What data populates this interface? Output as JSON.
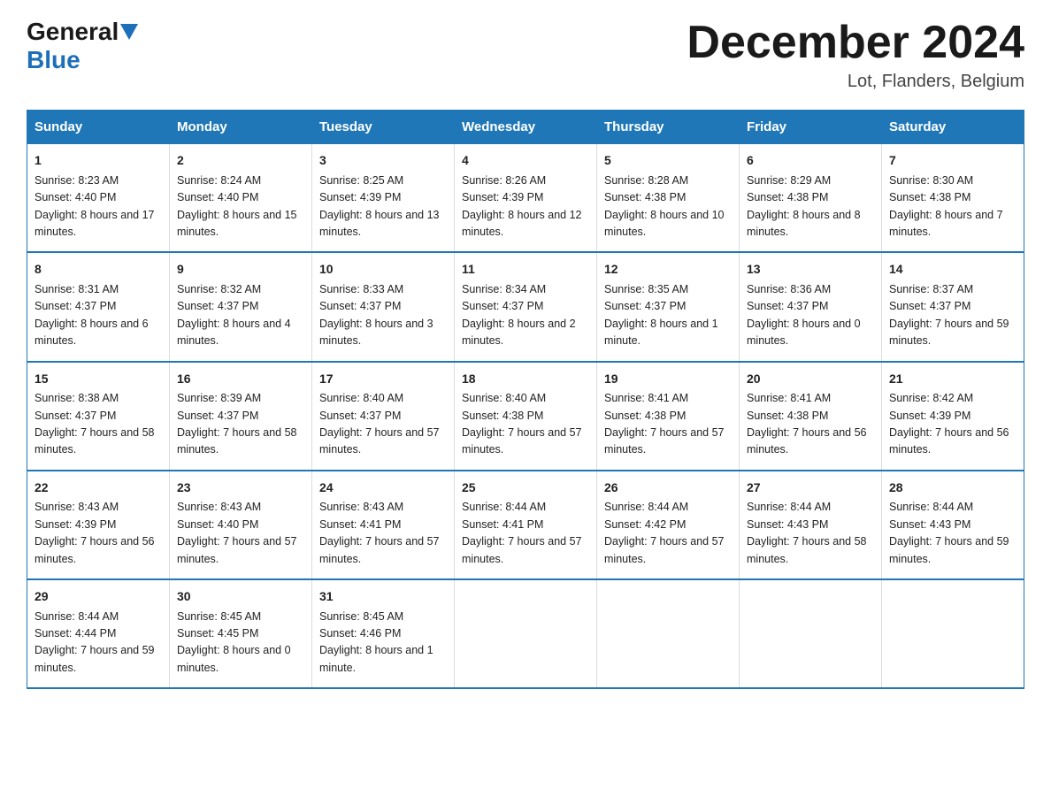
{
  "header": {
    "logo_general": "General",
    "logo_blue": "Blue",
    "month_title": "December 2024",
    "location": "Lot, Flanders, Belgium"
  },
  "days_of_week": [
    "Sunday",
    "Monday",
    "Tuesday",
    "Wednesday",
    "Thursday",
    "Friday",
    "Saturday"
  ],
  "weeks": [
    [
      {
        "day": "1",
        "sunrise": "8:23 AM",
        "sunset": "4:40 PM",
        "daylight": "8 hours and 17 minutes."
      },
      {
        "day": "2",
        "sunrise": "8:24 AM",
        "sunset": "4:40 PM",
        "daylight": "8 hours and 15 minutes."
      },
      {
        "day": "3",
        "sunrise": "8:25 AM",
        "sunset": "4:39 PM",
        "daylight": "8 hours and 13 minutes."
      },
      {
        "day": "4",
        "sunrise": "8:26 AM",
        "sunset": "4:39 PM",
        "daylight": "8 hours and 12 minutes."
      },
      {
        "day": "5",
        "sunrise": "8:28 AM",
        "sunset": "4:38 PM",
        "daylight": "8 hours and 10 minutes."
      },
      {
        "day": "6",
        "sunrise": "8:29 AM",
        "sunset": "4:38 PM",
        "daylight": "8 hours and 8 minutes."
      },
      {
        "day": "7",
        "sunrise": "8:30 AM",
        "sunset": "4:38 PM",
        "daylight": "8 hours and 7 minutes."
      }
    ],
    [
      {
        "day": "8",
        "sunrise": "8:31 AM",
        "sunset": "4:37 PM",
        "daylight": "8 hours and 6 minutes."
      },
      {
        "day": "9",
        "sunrise": "8:32 AM",
        "sunset": "4:37 PM",
        "daylight": "8 hours and 4 minutes."
      },
      {
        "day": "10",
        "sunrise": "8:33 AM",
        "sunset": "4:37 PM",
        "daylight": "8 hours and 3 minutes."
      },
      {
        "day": "11",
        "sunrise": "8:34 AM",
        "sunset": "4:37 PM",
        "daylight": "8 hours and 2 minutes."
      },
      {
        "day": "12",
        "sunrise": "8:35 AM",
        "sunset": "4:37 PM",
        "daylight": "8 hours and 1 minute."
      },
      {
        "day": "13",
        "sunrise": "8:36 AM",
        "sunset": "4:37 PM",
        "daylight": "8 hours and 0 minutes."
      },
      {
        "day": "14",
        "sunrise": "8:37 AM",
        "sunset": "4:37 PM",
        "daylight": "7 hours and 59 minutes."
      }
    ],
    [
      {
        "day": "15",
        "sunrise": "8:38 AM",
        "sunset": "4:37 PM",
        "daylight": "7 hours and 58 minutes."
      },
      {
        "day": "16",
        "sunrise": "8:39 AM",
        "sunset": "4:37 PM",
        "daylight": "7 hours and 58 minutes."
      },
      {
        "day": "17",
        "sunrise": "8:40 AM",
        "sunset": "4:37 PM",
        "daylight": "7 hours and 57 minutes."
      },
      {
        "day": "18",
        "sunrise": "8:40 AM",
        "sunset": "4:38 PM",
        "daylight": "7 hours and 57 minutes."
      },
      {
        "day": "19",
        "sunrise": "8:41 AM",
        "sunset": "4:38 PM",
        "daylight": "7 hours and 57 minutes."
      },
      {
        "day": "20",
        "sunrise": "8:41 AM",
        "sunset": "4:38 PM",
        "daylight": "7 hours and 56 minutes."
      },
      {
        "day": "21",
        "sunrise": "8:42 AM",
        "sunset": "4:39 PM",
        "daylight": "7 hours and 56 minutes."
      }
    ],
    [
      {
        "day": "22",
        "sunrise": "8:43 AM",
        "sunset": "4:39 PM",
        "daylight": "7 hours and 56 minutes."
      },
      {
        "day": "23",
        "sunrise": "8:43 AM",
        "sunset": "4:40 PM",
        "daylight": "7 hours and 57 minutes."
      },
      {
        "day": "24",
        "sunrise": "8:43 AM",
        "sunset": "4:41 PM",
        "daylight": "7 hours and 57 minutes."
      },
      {
        "day": "25",
        "sunrise": "8:44 AM",
        "sunset": "4:41 PM",
        "daylight": "7 hours and 57 minutes."
      },
      {
        "day": "26",
        "sunrise": "8:44 AM",
        "sunset": "4:42 PM",
        "daylight": "7 hours and 57 minutes."
      },
      {
        "day": "27",
        "sunrise": "8:44 AM",
        "sunset": "4:43 PM",
        "daylight": "7 hours and 58 minutes."
      },
      {
        "day": "28",
        "sunrise": "8:44 AM",
        "sunset": "4:43 PM",
        "daylight": "7 hours and 59 minutes."
      }
    ],
    [
      {
        "day": "29",
        "sunrise": "8:44 AM",
        "sunset": "4:44 PM",
        "daylight": "7 hours and 59 minutes."
      },
      {
        "day": "30",
        "sunrise": "8:45 AM",
        "sunset": "4:45 PM",
        "daylight": "8 hours and 0 minutes."
      },
      {
        "day": "31",
        "sunrise": "8:45 AM",
        "sunset": "4:46 PM",
        "daylight": "8 hours and 1 minute."
      },
      null,
      null,
      null,
      null
    ]
  ],
  "labels": {
    "sunrise": "Sunrise:",
    "sunset": "Sunset:",
    "daylight": "Daylight:"
  }
}
